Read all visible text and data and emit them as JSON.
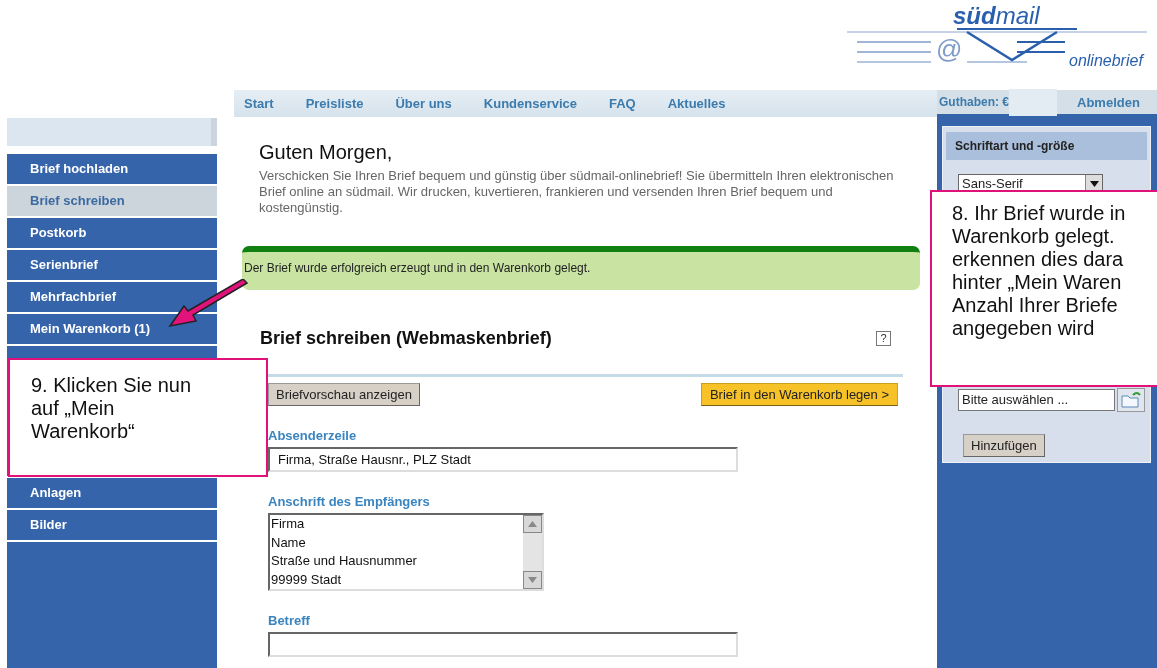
{
  "logo": {
    "at_sign": "@",
    "brand_bold": "süd",
    "brand_light": "mail",
    "tagline": "onlinebrief"
  },
  "nav": {
    "items": [
      {
        "label": "Start"
      },
      {
        "label": "Preisliste"
      },
      {
        "label": "Über uns"
      },
      {
        "label": "Kundenservice"
      },
      {
        "label": "FAQ"
      },
      {
        "label": "Aktuelles"
      }
    ],
    "balance_label": "Guthaben: €",
    "logout": "Abmelden"
  },
  "sidebar": {
    "items_top": [
      {
        "label": "Brief hochladen",
        "selected": false
      },
      {
        "label": "Brief schreiben",
        "selected": true
      },
      {
        "label": "Postkorb",
        "selected": false
      },
      {
        "label": "Serienbrief",
        "selected": false
      },
      {
        "label": "Mehrfachbrief",
        "selected": false
      },
      {
        "label": "Mein Warenkorb (1)",
        "selected": false
      }
    ],
    "items_bottom": [
      {
        "label": "Anlagen",
        "selected": false
      },
      {
        "label": "Bilder",
        "selected": false
      }
    ]
  },
  "main": {
    "greeting": "Guten Morgen,",
    "intro": "Verschicken Sie Ihren Brief bequem und günstig über südmail-onlinebrief! Sie übermitteln Ihren elektronischen Brief online an südmail. Wir drucken, kuvertieren, frankieren und versenden Ihren Brief bequem und kostengünstig.",
    "success_message": "Der Brief wurde erfolgreich erzeugt und in den Warenkorb gelegt.",
    "section_title": "Brief schreiben (Webmaskenbrief)",
    "help": "?",
    "preview_button": "Briefvorschau anzeigen",
    "cart_button": "Brief in den Warenkorb legen >",
    "sender_label": "Absenderzeile",
    "sender_value": "Firma, Straße Hausnr., PLZ Stadt",
    "recipient_label": "Anschrift des Empfängers",
    "recipient_lines": [
      "Firma",
      "Name",
      "Straße und Hausnummer",
      "99999 Stadt"
    ],
    "subject_label": "Betreff"
  },
  "right_panel": {
    "title": "Schriftart und -größe",
    "font_value": "Sans-Serif",
    "file_value": "Bitte auswählen ...",
    "add_button": "Hinzufügen"
  },
  "callouts": [
    {
      "kind": "sidebar",
      "lines": [
        "9. Klicken Sie nun",
        "auf „Mein",
        "Warenkorb“"
      ]
    },
    {
      "kind": "right",
      "lines": [
        "8. Ihr Brief wurde in",
        "Warenkorb gelegt.",
        "erkennen dies dara",
        "hinter „Mein Waren",
        "Anzahl Ihrer Briefe",
        "angegeben wird"
      ]
    }
  ]
}
